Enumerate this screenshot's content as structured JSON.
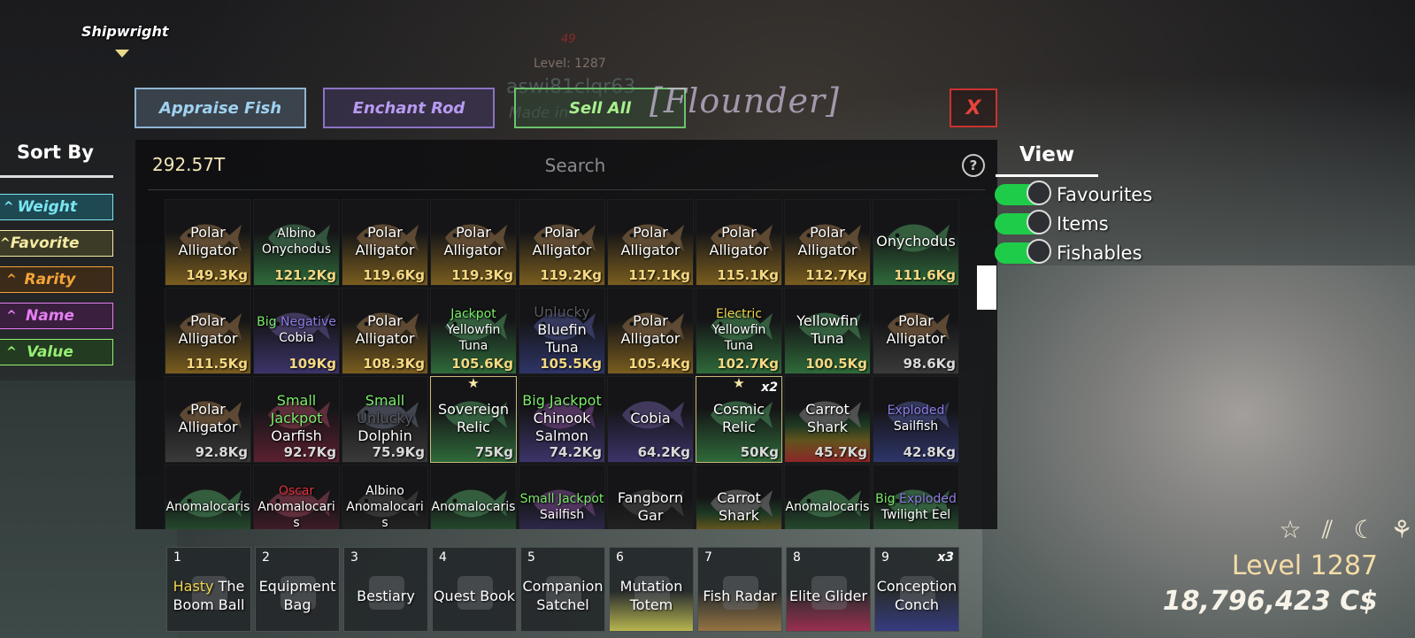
{
  "npc": {
    "name": "Shipwright"
  },
  "overhead": {
    "level": "Level: 1287",
    "number": "49",
    "username": "aswi81clqr63",
    "made": "Made in"
  },
  "top_buttons": {
    "appraise": "Appraise Fish",
    "enchant": "Enchant Rod",
    "sell_all": "Sell All",
    "title": "[Flounder]",
    "close": "X"
  },
  "inventory": {
    "money": "292.57T",
    "search_placeholder": "Search",
    "help": "?",
    "rows": [
      [
        {
          "name": [
            "Polar",
            "Alligator"
          ],
          "weight": "149.3Kg",
          "fish": "#6a5238",
          "grad": "#7a5d1f"
        },
        {
          "name": [
            "Albino",
            "Onychodus"
          ],
          "weight": "121.2Kg",
          "fish": "#395e45",
          "grad": "#2f6a3a",
          "small": true
        },
        {
          "name": [
            "Polar",
            "Alligator"
          ],
          "weight": "119.6Kg",
          "fish": "#6a5238",
          "grad": "#7a5d1f"
        },
        {
          "name": [
            "Polar",
            "Alligator"
          ],
          "weight": "119.3Kg",
          "fish": "#6a5238",
          "grad": "#7a5d1f"
        },
        {
          "name": [
            "Polar",
            "Alligator"
          ],
          "weight": "119.2Kg",
          "fish": "#6a5238",
          "grad": "#7a5d1f"
        },
        {
          "name": [
            "Polar",
            "Alligator"
          ],
          "weight": "117.1Kg",
          "fish": "#6a5238",
          "grad": "#7a5d1f"
        },
        {
          "name": [
            "Polar",
            "Alligator"
          ],
          "weight": "115.1Kg",
          "fish": "#6a5238",
          "grad": "#7a5d1f"
        },
        {
          "name": [
            "Polar",
            "Alligator"
          ],
          "weight": "112.7Kg",
          "fish": "#6a5238",
          "grad": "#7a5d1f"
        },
        {
          "name": [
            "Onychodus"
          ],
          "weight": "111.6Kg",
          "fish": "#3a6a45",
          "grad": "#2f6a3a"
        }
      ],
      [
        {
          "name": [
            "Polar",
            "Alligator"
          ],
          "weight": "111.5Kg",
          "fish": "#6a5238",
          "grad": "#7a5d1f"
        },
        {
          "mods": [
            {
              "t": "Big",
              "c": "m-green"
            },
            {
              "t": "Negative",
              "c": "m-purple"
            }
          ],
          "name": [
            "Cobia"
          ],
          "weight": "109Kg",
          "fish": "#4a3f6a",
          "grad": "#3c3469",
          "small": true
        },
        {
          "name": [
            "Polar",
            "Alligator"
          ],
          "weight": "108.3Kg",
          "fish": "#6a5238",
          "grad": "#7a5d1f"
        },
        {
          "mods": [
            {
              "t": "Jackpot",
              "c": "m-green"
            }
          ],
          "name": [
            "Yellowfin",
            "Tuna"
          ],
          "weight": "105.6Kg",
          "fish": "#3a6a45",
          "grad": "#2f6a3a",
          "small": true
        },
        {
          "mods": [
            {
              "t": "Unlucky",
              "c": "m-gray"
            }
          ],
          "name": [
            "Bluefin",
            "Tuna"
          ],
          "weight": "105.5Kg",
          "fish": "#3b3f6a",
          "grad": "#2e3568"
        },
        {
          "name": [
            "Polar",
            "Alligator"
          ],
          "weight": "105.4Kg",
          "fish": "#6a5238",
          "grad": "#7a5d1f"
        },
        {
          "mods": [
            {
              "t": "Electric",
              "c": "m-yellow"
            }
          ],
          "name": [
            "Yellowfin",
            "Tuna"
          ],
          "weight": "102.7Kg",
          "fish": "#3a6a45",
          "grad": "#2f6a3a",
          "small": true
        },
        {
          "name": [
            "Yellowfin",
            "Tuna"
          ],
          "weight": "100.5Kg",
          "fish": "#3a6a45",
          "grad": "#2f6a3a"
        },
        {
          "name": [
            "Polar",
            "Alligator"
          ],
          "weight": "98.6Kg",
          "fish": "#6a5238",
          "grad": "#3a3a3a",
          "plain": true
        }
      ],
      [
        {
          "name": [
            "Polar",
            "Alligator"
          ],
          "weight": "92.8Kg",
          "fish": "#6a5238",
          "grad": "#3a3a3a",
          "plain": true
        },
        {
          "mods": [
            {
              "t": "Small",
              "c": "m-green"
            },
            {
              "t": "Jackpot",
              "c": "m-green"
            }
          ],
          "name": [
            "Oarfish"
          ],
          "weight": "92.7Kg",
          "fish": "#6a3442",
          "grad": "#5a2030",
          "plain": true
        },
        {
          "mods": [
            {
              "t": "Small",
              "c": "m-green"
            },
            {
              "t": "Unlucky",
              "c": "m-gray"
            }
          ],
          "name": [
            "Dolphin"
          ],
          "weight": "75.9Kg",
          "fish": "#4a4f5a",
          "grad": "#3a3a3a",
          "plain": true
        },
        {
          "name": [
            "Sovereign",
            "Relic"
          ],
          "weight": "75Kg",
          "fish": "#3a6a45",
          "grad": "#2f6a3a",
          "plain": true,
          "star": true,
          "bordered": true
        },
        {
          "mods": [
            {
              "t": "Big",
              "c": "m-green"
            },
            {
              "t": "Jackpot",
              "c": "m-green"
            }
          ],
          "name": [
            "Chinook",
            "Salmon"
          ],
          "weight": "74.2Kg",
          "fish": "#5a3a6a",
          "grad": "#3c3469",
          "plain": true
        },
        {
          "name": [
            "Cobia"
          ],
          "weight": "64.2Kg",
          "fish": "#4a3f6a",
          "grad": "#3c3469",
          "plain": true
        },
        {
          "name": [
            "Cosmic",
            "Relic"
          ],
          "weight": "50Kg",
          "fish": "#3a6a45",
          "grad": "#2f6a3a",
          "plain": true,
          "star": true,
          "bordered": true,
          "count": "x2"
        },
        {
          "name": [
            "Carrot",
            "Shark"
          ],
          "weight": "45.7Kg",
          "fish": "#5a5a5a",
          "grad": "rainbow",
          "plain": true
        },
        {
          "mods": [
            {
              "t": "Exploded",
              "c": "m-purple"
            }
          ],
          "name": [
            "Sailfish"
          ],
          "weight": "42.8Kg",
          "fish": "#3b3f6a",
          "grad": "#2e3568",
          "plain": true,
          "small": true
        }
      ],
      [
        {
          "name": [
            "Anomalocaris"
          ],
          "weight": "",
          "fish": "#3a6a45",
          "grad": "#2f6a3a",
          "small": true
        },
        {
          "mods": [
            {
              "t": "Oscar",
              "c": "m-red"
            }
          ],
          "name": [
            "Anomalocari",
            "s"
          ],
          "weight": "",
          "fish": "#6a3442",
          "grad": "#5a2030",
          "small": true
        },
        {
          "mods": [
            {
              "t": "Albino",
              "c": ""
            }
          ],
          "name": [
            "Anomalocari",
            "s"
          ],
          "weight": "",
          "fish": "#3a3a3a",
          "grad": "#2a2a2a",
          "small": true
        },
        {
          "name": [
            "Anomalocaris"
          ],
          "weight": "",
          "fish": "#3a6a45",
          "grad": "#2f6a3a",
          "small": true
        },
        {
          "mods": [
            {
              "t": "Small",
              "c": "m-green"
            },
            {
              "t": "Jackpot",
              "c": "m-green"
            }
          ],
          "name": [
            "Sailfish"
          ],
          "weight": "",
          "fish": "#5a3a6a",
          "grad": "#3c3469",
          "small": true
        },
        {
          "name": [
            "Fangborn",
            "Gar"
          ],
          "weight": "",
          "fish": "#3a3a3a",
          "grad": "#2a2a2a"
        },
        {
          "name": [
            "Carrot",
            "Shark"
          ],
          "weight": "",
          "fish": "#5a5a5a",
          "grad": "rainbow"
        },
        {
          "name": [
            "Anomalocaris"
          ],
          "weight": "",
          "fish": "#3a6a45",
          "grad": "#2f6a3a",
          "small": true
        },
        {
          "mods": [
            {
              "t": "Big",
              "c": "m-green"
            },
            {
              "t": "Exploded",
              "c": "m-purple"
            }
          ],
          "name": [
            "Twilight Eel"
          ],
          "weight": "",
          "fish": "#3a6a45",
          "grad": "#2f6a3a",
          "small": true
        }
      ]
    ]
  },
  "sort": {
    "title": "Sort By",
    "options": [
      {
        "label": "Weight",
        "color": "#79e6f2",
        "bg": "rgba(30,80,90,.85)"
      },
      {
        "label": "Favorite",
        "color": "#f4eba3",
        "bg": "rgba(70,68,40,.75)"
      },
      {
        "label": "Rarity",
        "color": "#f3a437",
        "bg": "rgba(70,45,20,.75)"
      },
      {
        "label": "Name",
        "color": "#e67ef2",
        "bg": "rgba(65,30,70,.75)"
      },
      {
        "label": "Value",
        "color": "#96ee74",
        "bg": "rgba(35,65,30,.75)"
      }
    ]
  },
  "view": {
    "title": "View",
    "toggles": [
      {
        "label": "Favourites",
        "on": true
      },
      {
        "label": "Items",
        "on": true
      },
      {
        "label": "Fishables",
        "on": true
      }
    ]
  },
  "hotbar": [
    {
      "num": "1",
      "prefix": "Hasty",
      "label": "The Boom Ball",
      "grad": "#2a2a2a",
      "icon": "ball-icon"
    },
    {
      "num": "2",
      "label": "Equipment Bag",
      "grad": "#2a2a2a",
      "icon": "bag-icon"
    },
    {
      "num": "3",
      "label": "Bestiary",
      "grad": "#2a2a2a",
      "icon": "book-icon"
    },
    {
      "num": "4",
      "label": "Quest Book",
      "grad": "#2a2a2a",
      "icon": "quest-book-icon"
    },
    {
      "num": "5",
      "label": "Companion Satchel",
      "grad": "#2a2a2a",
      "icon": "satchel-icon"
    },
    {
      "num": "6",
      "label": "Mutation Totem",
      "grad": "#e7e25a",
      "icon": "totem-icon"
    },
    {
      "num": "7",
      "label": "Fish Radar",
      "grad": "#b98b4a",
      "icon": "radar-icon"
    },
    {
      "num": "8",
      "label": "Elite Glider",
      "grad": "#c0305a",
      "icon": "glider-icon"
    },
    {
      "num": "9",
      "label": "Conception Conch",
      "grad": "#3b3f9a",
      "icon": "conch-icon",
      "count": "x3"
    }
  ],
  "status": {
    "icons": [
      "star-icon",
      "rain-icon",
      "moon-icon",
      "sprout-icon"
    ],
    "level": "Level 1287",
    "cash": "18,796,423 C$"
  }
}
